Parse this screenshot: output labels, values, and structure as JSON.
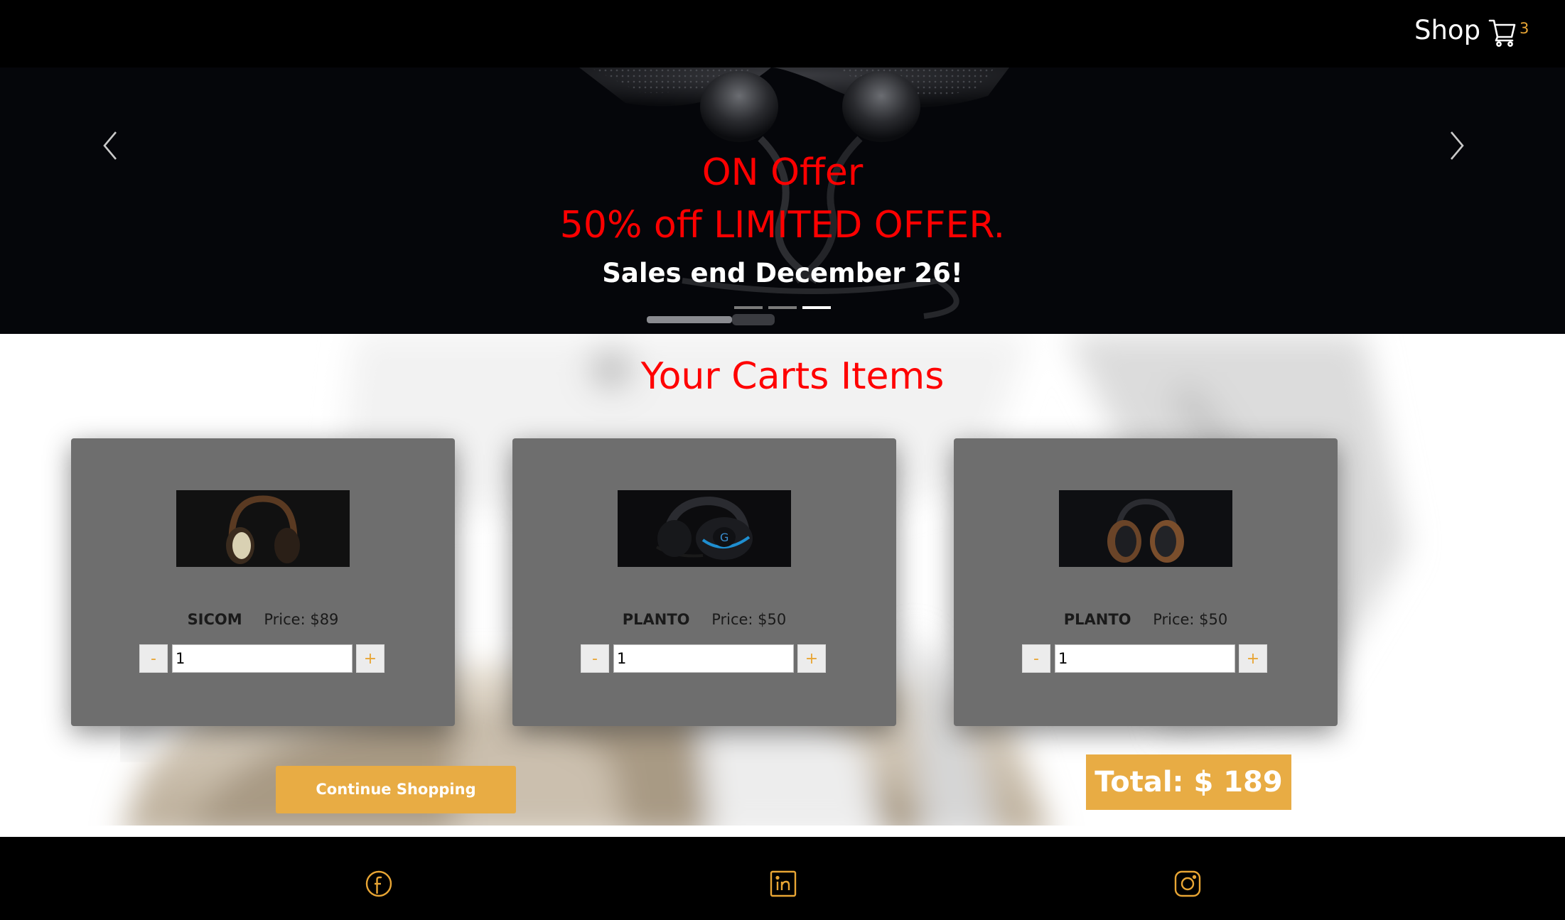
{
  "nav": {
    "shop_label": "Shop",
    "cart_icon": "cart-icon",
    "cart_count": "3",
    "accent_color": "#e8a534"
  },
  "hero": {
    "title": "ON Offer",
    "subtitle": "50% off LIMITED OFFER.",
    "note": "Sales end December 26!",
    "slide_count": 3,
    "active_slide": 3,
    "prev_icon": "chevron-left-icon",
    "next_icon": "chevron-right-icon",
    "highlight_color": "#ff0000"
  },
  "cart": {
    "heading": "Your Carts Items",
    "items": [
      {
        "name": "SICOM",
        "price_label": "Price: $89",
        "quantity": "1",
        "minus": "-",
        "plus": "+"
      },
      {
        "name": "PLANTO",
        "price_label": "Price: $50",
        "quantity": "1",
        "minus": "-",
        "plus": "+"
      },
      {
        "name": "PLANTO",
        "price_label": "Price: $50",
        "quantity": "1",
        "minus": "-",
        "plus": "+"
      }
    ],
    "continue_label": "Continue Shopping",
    "total_label": "Total: $ 189"
  },
  "footer": {
    "icons": [
      "facebook-icon",
      "linkedin-icon",
      "instagram-icon"
    ]
  }
}
